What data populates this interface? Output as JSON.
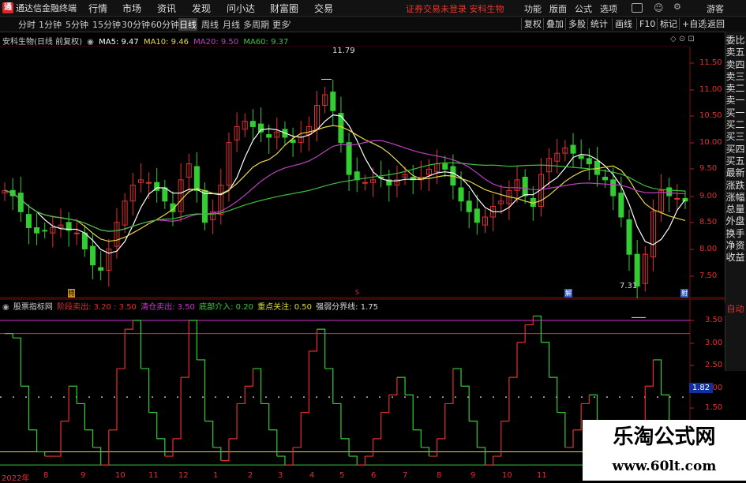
{
  "app": {
    "title": "通达信金融终端"
  },
  "menu": [
    "行情",
    "市场",
    "资讯",
    "发现",
    "问小达",
    "财富圈",
    "交易"
  ],
  "notice": "证券交易未登录  安科生物",
  "right_menu": [
    "功能",
    "版面",
    "公式",
    "选项",
    "游客"
  ],
  "toolbar": {
    "periods": [
      "分时",
      "1分钟",
      "5分钟",
      "15分钟",
      "30分钟",
      "60分钟",
      "日线",
      "周线",
      "月线",
      "多周期",
      "更多"
    ],
    "active": "日线",
    "right_buttons": [
      "复权",
      "叠加",
      "多股",
      "统计",
      "画线",
      "F10",
      "标记",
      "+自选",
      "返回"
    ]
  },
  "stock_info": {
    "name": "安科生物(日线 前复权)",
    "ma5": "MA5: 9.47",
    "ma10": "MA10: 9.46",
    "ma20": "MA20: 9.50",
    "ma60": "MA60: 9.37"
  },
  "price_axis": [
    "11.50",
    "11.00",
    "10.50",
    "10.00",
    "9.50",
    "9.00",
    "8.50",
    "8.00",
    "7.50"
  ],
  "price_markers": {
    "high": "11.79",
    "low": "7.31"
  },
  "right_panel": [
    "委比",
    "卖五",
    "卖四",
    "卖三",
    "卖二",
    "卖一",
    "买一",
    "买二",
    "买三",
    "买四",
    "买五",
    "最新",
    "涨跌",
    "涨幅",
    "总量",
    "外盘",
    "换手",
    "净资",
    "收益"
  ],
  "auto_button": "自动",
  "indicator_info": {
    "name": "股票指标网",
    "items": [
      {
        "label": "阶段卖出: 3.20 : 3.50",
        "color": "#e03030"
      },
      {
        "label": "清仓卖出: 3.50",
        "color": "#cc33cc"
      },
      {
        "label": "底部介入: 0.20",
        "color": "#33cc33"
      },
      {
        "label": "重点关注: 0.50",
        "color": "#dddd33"
      },
      {
        "label": "强弱分界线: 1.75",
        "color": "#dddddd"
      }
    ]
  },
  "indicator_axis": [
    "3.50",
    "3.00",
    "2.50",
    "2.00",
    "1.50"
  ],
  "indicator_current": "1.82",
  "x_axis": [
    "2022年",
    "8",
    "9",
    "10",
    "11",
    "12",
    "1",
    "2",
    "3",
    "4",
    "5",
    "6",
    "7",
    "8",
    "9",
    "10",
    "11"
  ],
  "watermark": {
    "line1": "乐淘公式网",
    "line2": "www.60lt.com"
  },
  "event_flags": [
    "特",
    "S",
    "解",
    "射"
  ],
  "colors": {
    "up": "#e03030",
    "down": "#33cc33",
    "ma5": "#ffffff",
    "ma10": "#e8d84a",
    "ma20": "#c040c0",
    "ma60": "#40c040"
  }
}
